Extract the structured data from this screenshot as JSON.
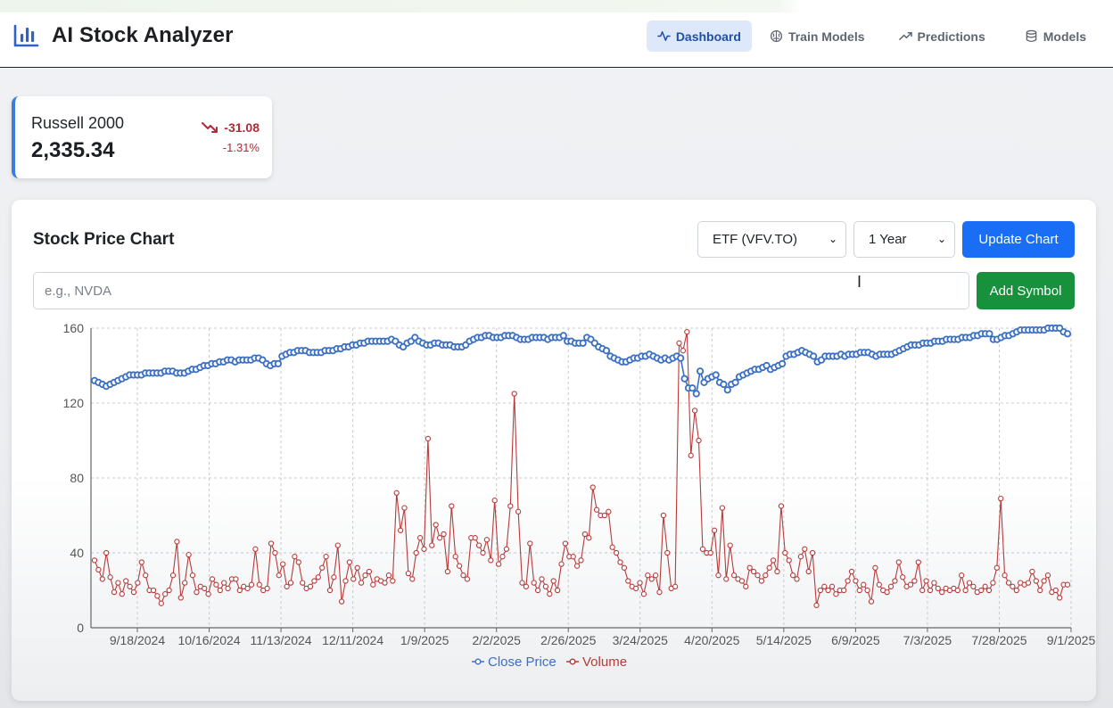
{
  "app": {
    "title": "AI Stock Analyzer",
    "nav": [
      {
        "label": "Dashboard",
        "icon": "activity-icon",
        "active": true
      },
      {
        "label": "Train Models",
        "icon": "brain-icon",
        "active": false
      },
      {
        "label": "Predictions",
        "icon": "trending-up-icon",
        "active": false
      },
      {
        "label": "Models",
        "icon": "database-icon",
        "active": false
      }
    ]
  },
  "index_card": {
    "name": "Russell 2000",
    "value": "2,335.34",
    "change": "-31.08",
    "change_pct": "-1.31%",
    "trend": "down",
    "color": "#b02a37"
  },
  "chart_panel": {
    "title": "Stock Price Chart",
    "symbol_select": "ETF (VFV.TO)",
    "period_select": "1 Year",
    "update_button": "Update Chart",
    "symbol_placeholder": "e.g., NVDA",
    "add_button": "Add Symbol"
  },
  "chart_data": {
    "type": "line",
    "x_tick_labels": [
      "9/18/2024",
      "10/16/2024",
      "11/13/2024",
      "12/11/2024",
      "1/9/2025",
      "2/2/2025",
      "2/26/2025",
      "3/24/2025",
      "4/20/2025",
      "5/14/2025",
      "6/9/2025",
      "7/3/2025",
      "7/28/2025",
      "9/1/2025"
    ],
    "y_ticks": [
      0,
      40,
      80,
      120,
      160
    ],
    "ylim": [
      0,
      160
    ],
    "grid": true,
    "legend_position": "bottom",
    "series": [
      {
        "name": "Close Price",
        "color": "#3a6fc4",
        "values": [
          132,
          131,
          130,
          129,
          130,
          131,
          132,
          133,
          134,
          135,
          135,
          135,
          135,
          136,
          136,
          136,
          136,
          136,
          137,
          137,
          137,
          136,
          136,
          136,
          137,
          138,
          138,
          139,
          140,
          140,
          141,
          141,
          142,
          142,
          143,
          143,
          142,
          143,
          143,
          143,
          143,
          144,
          144,
          143,
          141,
          140,
          141,
          141,
          145,
          146,
          147,
          147,
          148,
          148,
          148,
          147,
          147,
          147,
          147,
          148,
          148,
          148,
          149,
          149,
          150,
          150,
          151,
          151,
          152,
          152,
          153,
          153,
          153,
          153,
          153,
          153,
          154,
          153,
          151,
          150,
          152,
          153,
          155,
          153,
          152,
          151,
          151,
          152,
          152,
          151,
          151,
          151,
          150,
          150,
          150,
          151,
          153,
          154,
          155,
          155,
          156,
          156,
          155,
          155,
          155,
          156,
          156,
          156,
          155,
          154,
          154,
          154,
          155,
          155,
          155,
          155,
          154,
          155,
          155,
          155,
          156,
          153,
          153,
          152,
          152,
          152,
          155,
          154,
          152,
          150,
          149,
          148,
          145,
          144,
          143,
          142,
          142,
          143,
          144,
          144,
          145,
          145,
          146,
          145,
          144,
          143,
          144,
          143,
          144,
          145,
          144,
          133,
          128,
          128,
          125,
          137,
          131,
          133,
          134,
          135,
          131,
          130,
          127,
          130,
          131,
          134,
          135,
          136,
          137,
          138,
          138,
          139,
          140,
          138,
          139,
          140,
          141,
          145,
          146,
          146,
          147,
          148,
          147,
          146,
          145,
          142,
          143,
          145,
          145,
          145,
          145,
          146,
          145,
          146,
          146,
          146,
          147,
          147,
          147,
          146,
          145,
          146,
          146,
          146,
          146,
          147,
          148,
          149,
          150,
          151,
          151,
          151,
          152,
          152,
          152,
          153,
          153,
          153,
          154,
          154,
          154,
          154,
          155,
          155,
          155,
          156,
          156,
          157,
          157,
          157,
          154,
          154,
          155,
          156,
          156,
          157,
          158,
          159,
          159,
          159,
          159,
          159,
          159,
          159,
          160,
          160,
          160,
          160,
          158,
          157
        ]
      },
      {
        "name": "Volume",
        "color": "#b83a3a",
        "values": [
          36,
          31,
          26,
          40,
          27,
          19,
          24,
          18,
          25,
          22,
          19,
          24,
          35,
          28,
          20,
          20,
          17,
          13,
          18,
          20,
          28,
          46,
          16,
          24,
          39,
          28,
          19,
          22,
          21,
          18,
          26,
          23,
          20,
          24,
          21,
          26,
          26,
          20,
          22,
          21,
          23,
          42,
          23,
          20,
          21,
          45,
          40,
          28,
          34,
          22,
          24,
          38,
          35,
          24,
          21,
          22,
          25,
          27,
          32,
          38,
          20,
          27,
          44,
          14,
          25,
          35,
          26,
          32,
          24,
          28,
          30,
          23,
          26,
          25,
          24,
          28,
          25,
          72,
          52,
          64,
          29,
          26,
          40,
          48,
          42,
          101,
          44,
          55,
          48,
          50,
          30,
          65,
          38,
          33,
          28,
          26,
          48,
          48,
          44,
          40,
          47,
          36,
          68,
          34,
          38,
          42,
          65,
          125,
          62,
          24,
          22,
          45,
          24,
          20,
          26,
          22,
          18,
          25,
          20,
          34,
          45,
          38,
          38,
          33,
          36,
          50,
          48,
          75,
          63,
          60,
          60,
          62,
          43,
          40,
          35,
          32,
          25,
          22,
          21,
          24,
          18,
          28,
          26,
          28,
          19,
          60,
          40,
          21,
          22,
          152,
          148,
          158,
          92,
          116,
          100,
          42,
          40,
          40,
          52,
          28,
          64,
          26,
          44,
          28,
          26,
          25,
          22,
          32,
          30,
          28,
          25,
          28,
          32,
          36,
          30,
          65,
          40,
          36,
          28,
          26,
          38,
          42,
          30,
          40,
          12,
          20,
          22,
          20,
          22,
          18,
          20,
          20,
          25,
          30,
          25,
          20,
          23,
          20,
          14,
          32,
          23,
          20,
          19,
          22,
          25,
          35,
          27,
          22,
          23,
          25,
          35,
          20,
          25,
          20,
          24,
          21,
          19,
          21,
          20,
          21,
          20,
          28,
          20,
          24,
          22,
          19,
          20,
          22,
          20,
          24,
          32,
          69,
          28,
          24,
          22,
          20,
          24,
          23,
          24,
          30,
          25,
          20,
          25,
          28,
          19,
          20,
          16,
          23,
          23
        ]
      }
    ]
  }
}
